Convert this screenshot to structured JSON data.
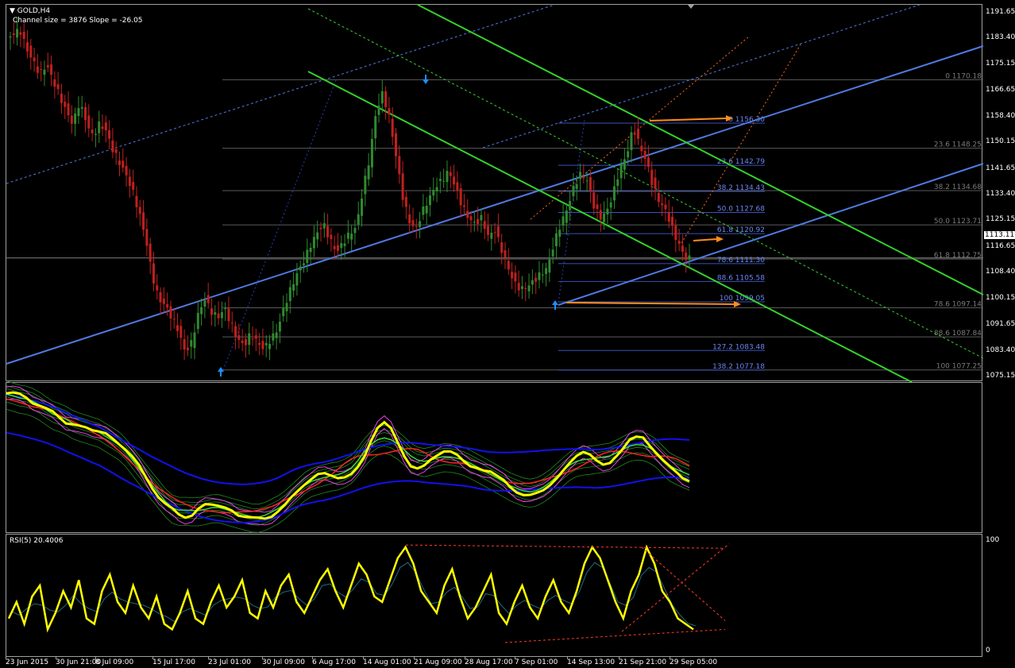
{
  "chart_title": "GOLD,H4",
  "channel_info": "Channel size = 3876 Slope = -26.05",
  "current_price": "1113.11",
  "rsi_label": "RSI(5) 20.4006",
  "rsi_scale": [
    "100",
    "0"
  ],
  "colors": {
    "background": "#000000",
    "bull_candle": "#2f8a2f",
    "bear_candle": "#c0201e",
    "channel_green": "#34d12c",
    "channel_blue": "#4f7ae0",
    "fib_line": "#5a5a5a",
    "orange_arrow": "#ff8c1a",
    "rsi_line": "#ffff00",
    "ma_yellow": "#ffff00",
    "ma_magenta": "#ff44ff",
    "ma_red": "#ff2222",
    "ma_blue": "#1111ee"
  },
  "icons": [
    "dropdown-triangle-icon",
    "up-arrow-marker-icon",
    "down-arrow-marker-icon"
  ],
  "chart_data": {
    "type": "candlestick",
    "title": "GOLD,H4",
    "y_axis_ticks": [
      "1191.65",
      "1183.40",
      "1175.15",
      "1166.65",
      "1158.40",
      "1150.15",
      "1141.65",
      "1133.40",
      "1125.15",
      "1116.65",
      "1108.40",
      "1100.15",
      "1091.65",
      "1083.40",
      "1075.15"
    ],
    "ylim": [
      1075.15,
      1191.65
    ],
    "x_axis_ticks": [
      "23 Jun 2015",
      "30 Jun 21:00",
      "8 Jul 09:00",
      "15 Jul 17:00",
      "23 Jul 01:00",
      "30 Jul 09:00",
      "6 Aug 17:00",
      "14 Aug 01:00",
      "21 Aug 09:00",
      "28 Aug 17:00",
      "7 Sep 01:00",
      "14 Sep 13:00",
      "21 Sep 21:00",
      "29 Sep 05:00"
    ],
    "price_path": [
      1183,
      1185,
      1186,
      1180,
      1176,
      1172,
      1175,
      1170,
      1165,
      1160,
      1156,
      1163,
      1157,
      1152,
      1156,
      1154,
      1148,
      1144,
      1140,
      1135,
      1128,
      1120,
      1108,
      1100,
      1098,
      1094,
      1090,
      1083,
      1086,
      1095,
      1100,
      1096,
      1094,
      1097,
      1092,
      1087,
      1085,
      1089,
      1086,
      1084,
      1087,
      1090,
      1097,
      1103,
      1108,
      1112,
      1117,
      1121,
      1124,
      1119,
      1115,
      1118,
      1121,
      1123,
      1135,
      1145,
      1160,
      1166,
      1158,
      1146,
      1133,
      1125,
      1122,
      1128,
      1132,
      1136,
      1138,
      1141,
      1136,
      1130,
      1126,
      1124,
      1126,
      1120,
      1122,
      1116,
      1110,
      1105,
      1103,
      1104,
      1106,
      1108,
      1110,
      1118,
      1124,
      1129,
      1136,
      1140,
      1138,
      1130,
      1126,
      1128,
      1134,
      1142,
      1146,
      1155,
      1149,
      1144,
      1136,
      1131,
      1128,
      1122,
      1117,
      1113
    ],
    "fib_left": [
      {
        "label": "0 1170.18",
        "value": 1170.18
      },
      {
        "label": "23.6 1148.25",
        "value": 1148.25
      },
      {
        "label": "38.2 1134.68",
        "value": 1134.68
      },
      {
        "label": "50.0 1123.71",
        "value": 1123.71
      },
      {
        "label": "61.8 1112.75",
        "value": 1112.75
      },
      {
        "label": "78.6 1097.14",
        "value": 1097.14
      },
      {
        "label": "88.6 1087.84",
        "value": 1087.84
      },
      {
        "label": "100 1077.25",
        "value": 1077.25
      }
    ],
    "fib_right": [
      {
        "label": "0 1156.30",
        "value": 1156.3
      },
      {
        "label": "23.6 1142.79",
        "value": 1142.79
      },
      {
        "label": "38.2 1134.43",
        "value": 1134.43
      },
      {
        "label": "50.0 1127.68",
        "value": 1127.68
      },
      {
        "label": "61.8 1120.92",
        "value": 1120.92
      },
      {
        "label": "78.6 1111.30",
        "value": 1111.3
      },
      {
        "label": "88.6 1105.58",
        "value": 1105.58
      },
      {
        "label": "100 1099.05",
        "value": 1099.05
      },
      {
        "label": "127.2 1083.48",
        "value": 1083.48
      },
      {
        "label": "138.2 1077.18",
        "value": 1077.18
      }
    ],
    "rsi_values": [
      30,
      45,
      25,
      50,
      60,
      20,
      35,
      55,
      40,
      65,
      30,
      25,
      55,
      70,
      45,
      35,
      60,
      40,
      30,
      50,
      25,
      20,
      35,
      55,
      30,
      25,
      45,
      60,
      40,
      50,
      65,
      35,
      30,
      55,
      40,
      60,
      70,
      45,
      35,
      50,
      65,
      75,
      55,
      40,
      60,
      80,
      70,
      50,
      45,
      65,
      85,
      95,
      80,
      55,
      45,
      35,
      60,
      75,
      50,
      30,
      40,
      55,
      70,
      35,
      25,
      45,
      60,
      40,
      30,
      50,
      65,
      45,
      35,
      55,
      80,
      95,
      85,
      65,
      45,
      30,
      55,
      70,
      95,
      80,
      55,
      45,
      30,
      25,
      20
    ]
  }
}
